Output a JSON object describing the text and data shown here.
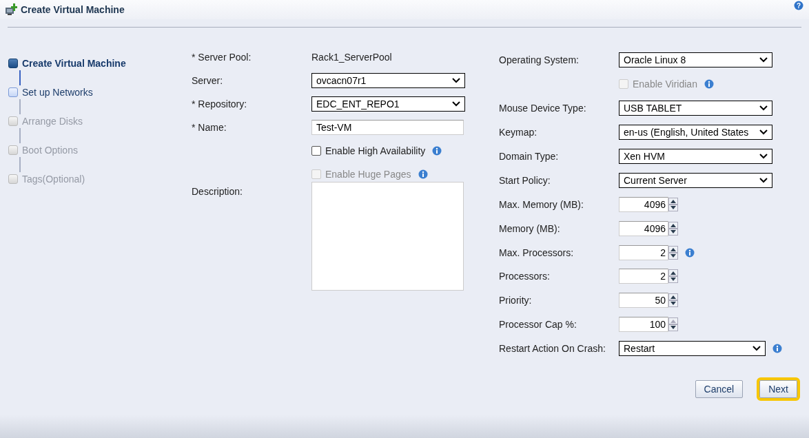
{
  "window": {
    "title": "Create Virtual Machine",
    "help": "?"
  },
  "steps": [
    {
      "label": "Create Virtual Machine",
      "selected": true,
      "disabled": false
    },
    {
      "label": "Set up Networks",
      "selected": false,
      "disabled": false
    },
    {
      "label": "Arrange Disks",
      "selected": false,
      "disabled": true
    },
    {
      "label": "Boot Options",
      "selected": false,
      "disabled": true
    },
    {
      "label": "Tags(Optional)",
      "selected": false,
      "disabled": true
    }
  ],
  "left_fields": [
    {
      "kind": "static",
      "label": "* Server Pool:",
      "value": "Rack1_ServerPool"
    },
    {
      "kind": "select",
      "label": "Server:",
      "value": "ovcacn07r1"
    },
    {
      "kind": "select",
      "label": "* Repository:",
      "value": "EDC_ENT_REPO1"
    },
    {
      "kind": "text",
      "label": "* Name:",
      "value": "Test-VM"
    },
    {
      "kind": "checkbox",
      "text": "Enable High Availability",
      "checked": false,
      "disabled": false,
      "info": true
    },
    {
      "kind": "checkbox",
      "text": "Enable Huge Pages",
      "checked": false,
      "disabled": true,
      "info": true
    },
    {
      "kind": "textarea",
      "label": "Description:"
    }
  ],
  "right_fields": [
    {
      "kind": "select",
      "label": "Operating System:",
      "value": "Oracle Linux 8"
    },
    {
      "kind": "checkbox",
      "text": "Enable Viridian",
      "checked": false,
      "disabled": true,
      "info": true
    },
    {
      "kind": "select",
      "label": "Mouse Device Type:",
      "value": "USB TABLET"
    },
    {
      "kind": "select",
      "label": "Keymap:",
      "value": "en-us (English, United States"
    },
    {
      "kind": "select",
      "label": "Domain Type:",
      "value": "Xen HVM"
    },
    {
      "kind": "select",
      "label": "Start Policy:",
      "value": "Current Server"
    },
    {
      "kind": "spinner",
      "label": "Max. Memory (MB):",
      "value": "4096",
      "up_disabled": false
    },
    {
      "kind": "spinner",
      "label": "Memory (MB):",
      "value": "4096",
      "up_disabled": false
    },
    {
      "kind": "spinner",
      "label": "Max. Processors:",
      "value": "2",
      "up_disabled": false,
      "info": true
    },
    {
      "kind": "spinner",
      "label": "Processors:",
      "value": "2",
      "up_disabled": false
    },
    {
      "kind": "spinner",
      "label": "Priority:",
      "value": "50",
      "up_disabled": false
    },
    {
      "kind": "spinner",
      "label": "Processor Cap %:",
      "value": "100",
      "up_disabled": true
    },
    {
      "kind": "wideselect",
      "label": "Restart Action On Crash:",
      "value": "Restart",
      "info": true
    }
  ],
  "buttons": [
    {
      "label": "Cancel",
      "focused": false
    },
    {
      "label": "Next",
      "focused": true
    }
  ]
}
